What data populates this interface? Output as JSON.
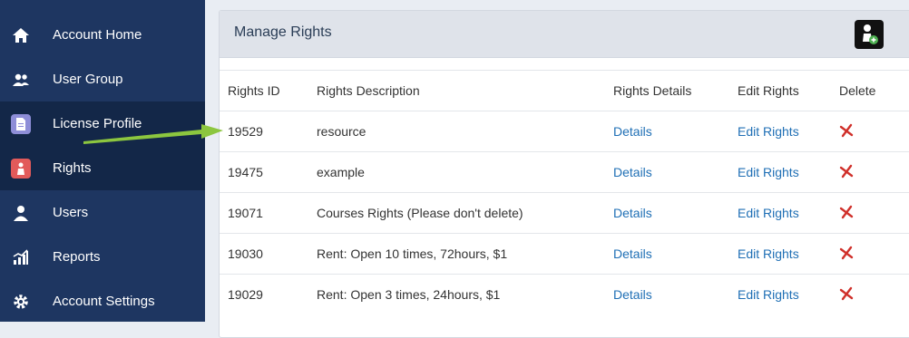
{
  "sidebar": {
    "items": [
      {
        "label": "Account Home",
        "icon": "home-icon"
      },
      {
        "label": "User Group",
        "icon": "user-group-icon"
      },
      {
        "label": "License Profile",
        "icon": "document-icon"
      },
      {
        "label": "Rights",
        "icon": "lock-icon"
      },
      {
        "label": "Users",
        "icon": "user-icon"
      },
      {
        "label": "Reports",
        "icon": "chart-icon"
      },
      {
        "label": "Account Settings",
        "icon": "gear-icon"
      }
    ],
    "active_index": 3
  },
  "panel": {
    "title": "Manage Rights",
    "add_button_icon": "add-user-icon"
  },
  "table": {
    "headers": [
      "Rights ID",
      "Rights Description",
      "Rights Details",
      "Edit Rights",
      "Delete"
    ],
    "rows": [
      {
        "id": "19529",
        "description": "resource",
        "details": "Details",
        "edit": "Edit Rights"
      },
      {
        "id": "19475",
        "description": "example",
        "details": "Details",
        "edit": "Edit Rights"
      },
      {
        "id": "19071",
        "description": "Courses Rights (Please don't delete)",
        "details": "Details",
        "edit": "Edit Rights"
      },
      {
        "id": "19030",
        "description": "Rent: Open 10 times, 72hours, $1",
        "details": "Details",
        "edit": "Edit Rights"
      },
      {
        "id": "19029",
        "description": "Rent: Open 3 times, 24hours, $1",
        "details": "Details",
        "edit": "Edit Rights"
      }
    ]
  },
  "colors": {
    "sidebar_bg": "#1e3661",
    "sidebar_active": "#132748",
    "link": "#1f6fb5",
    "delete": "#d0302a",
    "arrow": "#8cc63f"
  }
}
